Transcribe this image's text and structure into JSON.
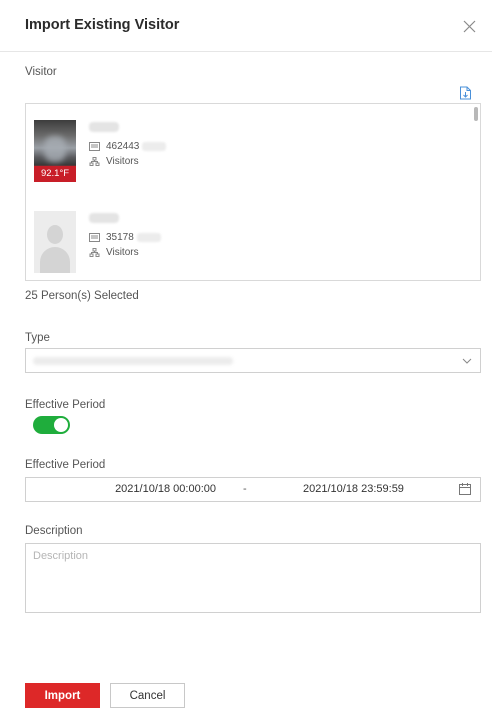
{
  "dialog": {
    "title": "Import Existing Visitor"
  },
  "visitor": {
    "label": "Visitor",
    "persons": [
      {
        "id_prefix": "462443",
        "group": "Visitors",
        "temperature": "92.1°F",
        "photo": "thermal-capture"
      },
      {
        "id_prefix": "35178",
        "group": "Visitors",
        "temperature": "",
        "photo": "default-avatar"
      }
    ],
    "selected_count": "25 Person(s) Selected"
  },
  "type": {
    "label": "Type"
  },
  "effective_toggle": {
    "label": "Effective Period",
    "enabled": true
  },
  "effective_period": {
    "label": "Effective Period",
    "start": "2021/10/18 00:00:00",
    "separator": "-",
    "end": "2021/10/18 23:59:59"
  },
  "description": {
    "label": "Description",
    "placeholder": "Description"
  },
  "footer": {
    "import_label": "Import",
    "cancel_label": "Cancel"
  },
  "colors": {
    "primary": "#dd2828",
    "toggle_on": "#1fad3c",
    "temperature_alert": "#c81e28"
  }
}
